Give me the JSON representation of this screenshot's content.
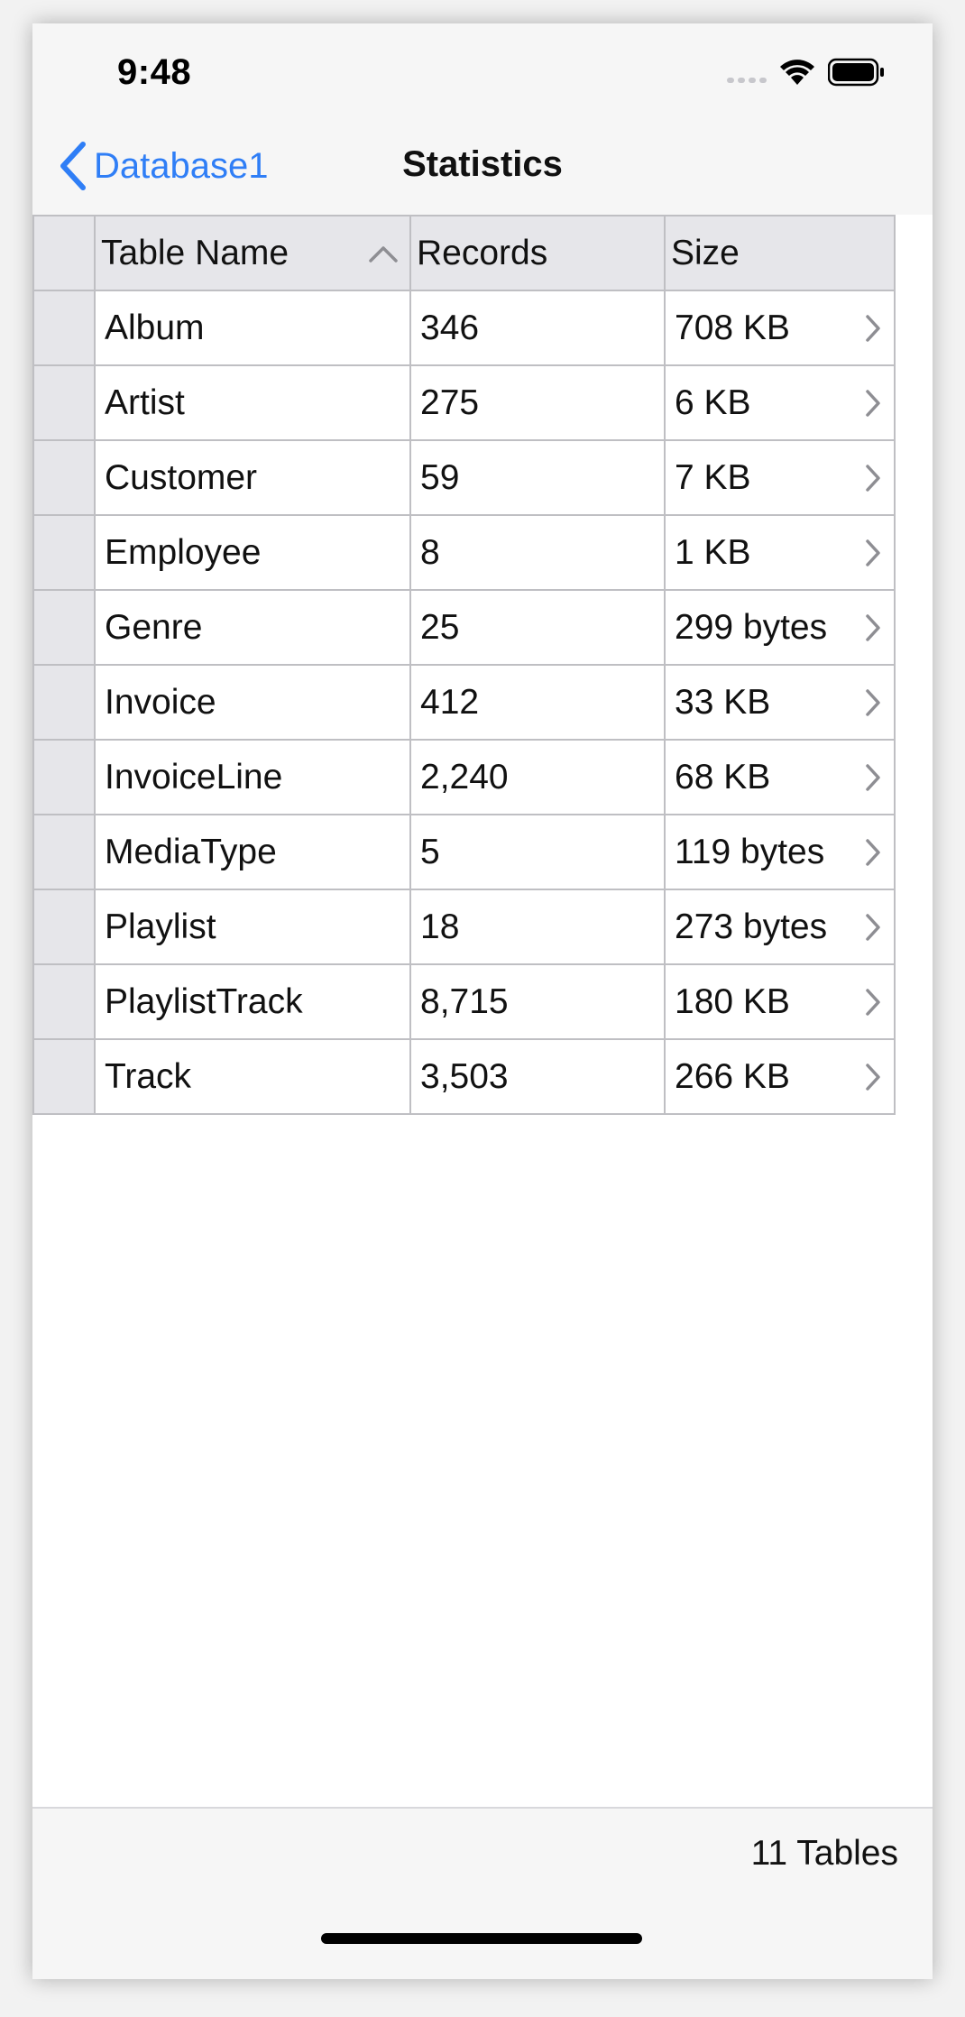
{
  "status_bar": {
    "time": "9:48"
  },
  "nav": {
    "back_label": "Database1",
    "title": "Statistics"
  },
  "table": {
    "headers": {
      "name": "Table Name",
      "records": "Records",
      "size": "Size"
    },
    "rows": [
      {
        "name": "Album",
        "records": "346",
        "size": "708 KB"
      },
      {
        "name": "Artist",
        "records": "275",
        "size": "6 KB"
      },
      {
        "name": "Customer",
        "records": "59",
        "size": "7 KB"
      },
      {
        "name": "Employee",
        "records": "8",
        "size": "1 KB"
      },
      {
        "name": "Genre",
        "records": "25",
        "size": "299 bytes"
      },
      {
        "name": "Invoice",
        "records": "412",
        "size": "33 KB"
      },
      {
        "name": "InvoiceLine",
        "records": "2,240",
        "size": "68 KB"
      },
      {
        "name": "MediaType",
        "records": "5",
        "size": "119 bytes"
      },
      {
        "name": "Playlist",
        "records": "18",
        "size": "273 bytes"
      },
      {
        "name": "PlaylistTrack",
        "records": "8,715",
        "size": "180 KB"
      },
      {
        "name": "Track",
        "records": "3,503",
        "size": "266 KB"
      }
    ]
  },
  "footer": {
    "count": "11 Tables"
  },
  "colors": {
    "accent": "#2f7ef6",
    "header_bg": "#e6e6ea",
    "grid_line": "#bfbfc3"
  }
}
